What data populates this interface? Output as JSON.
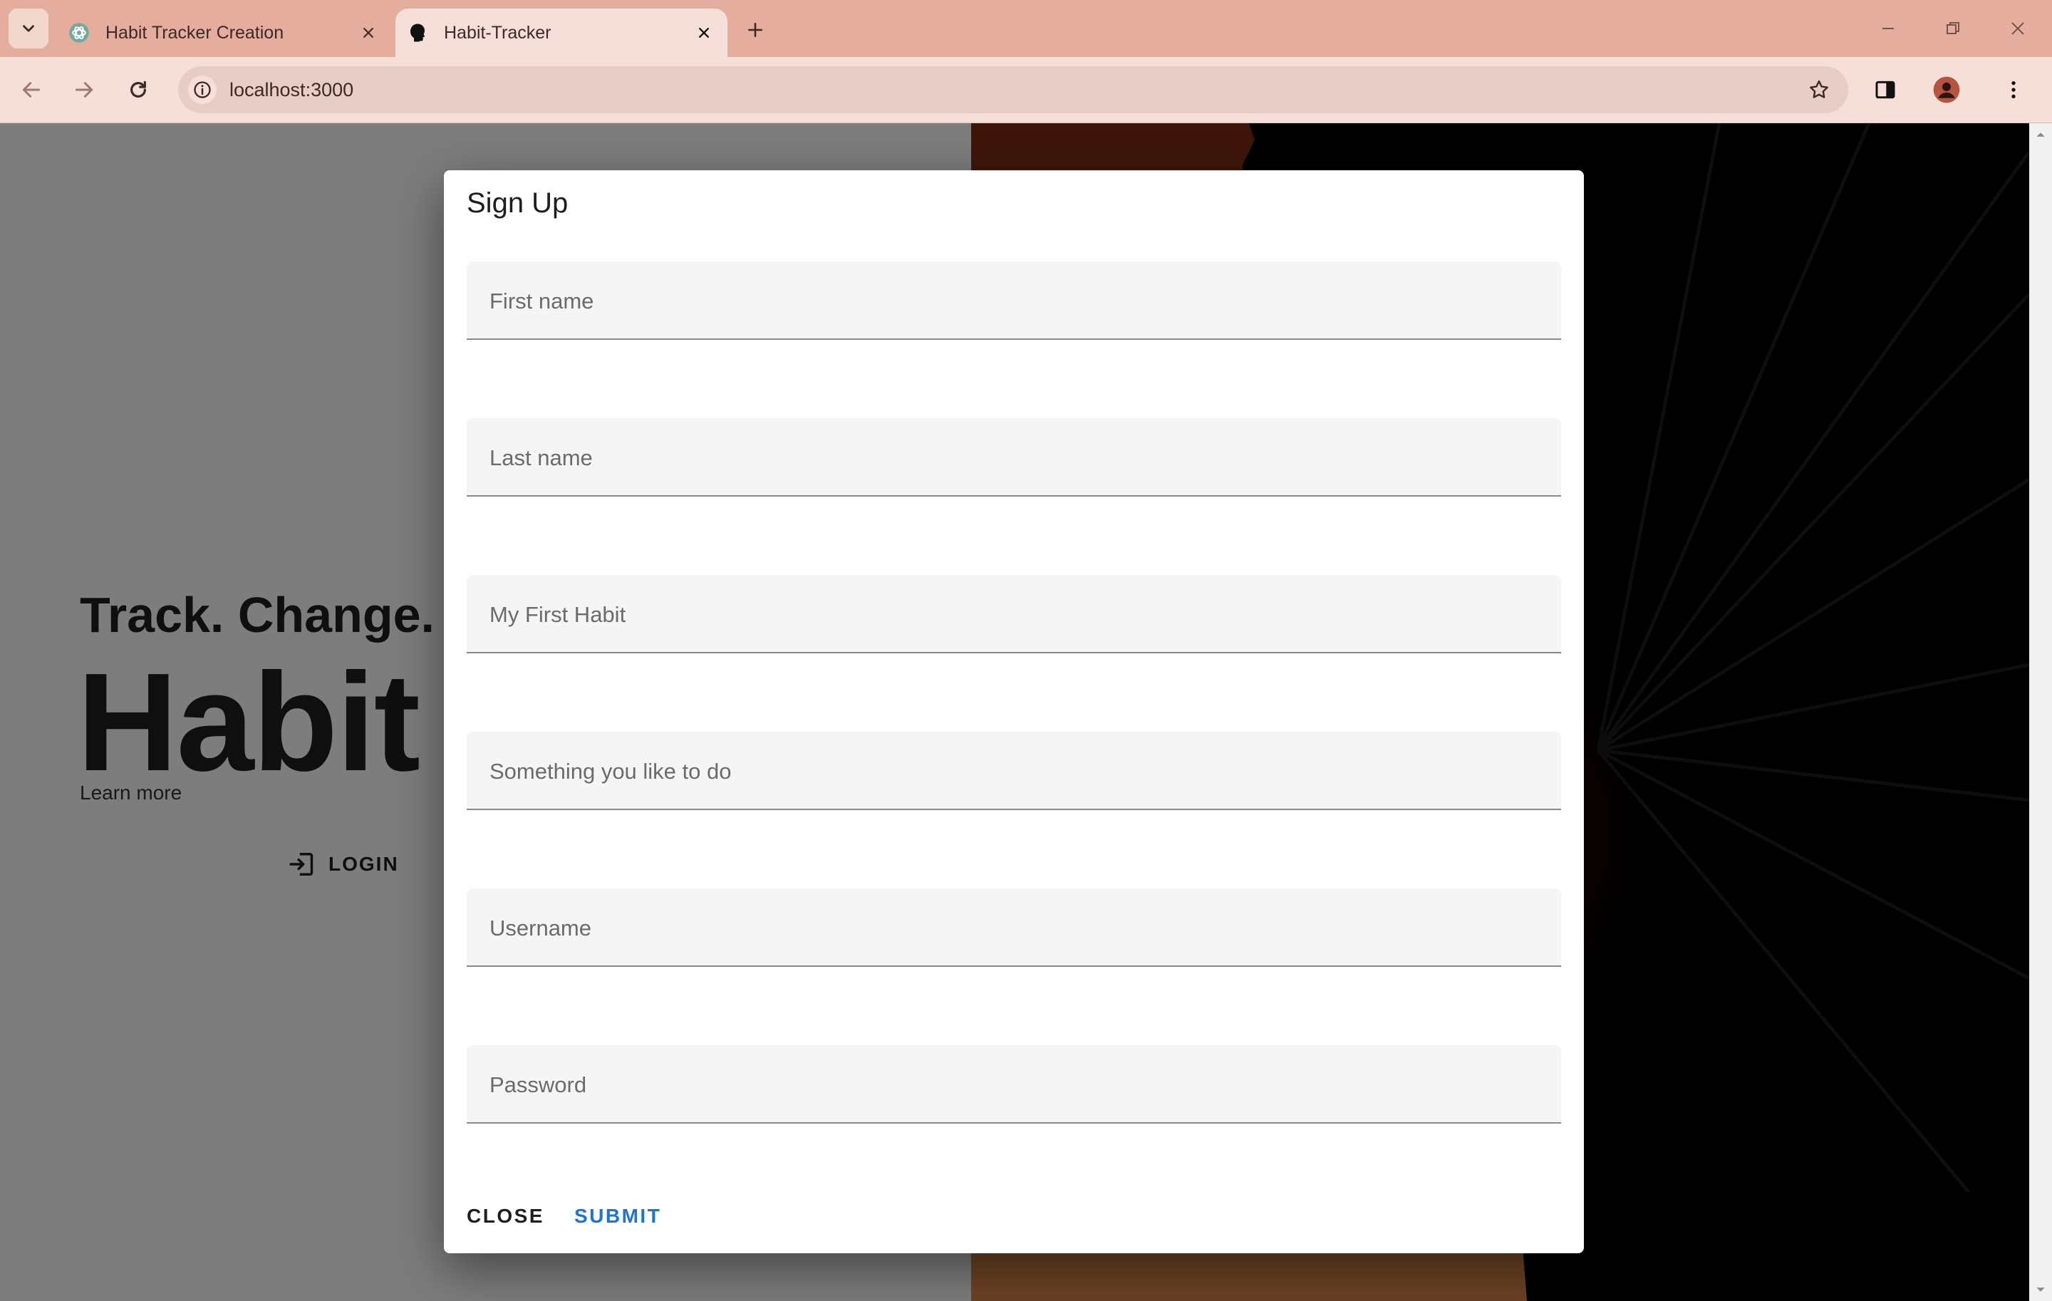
{
  "browser": {
    "tabs": [
      {
        "title": "Habit Tracker Creation",
        "icon": "openai-logo-icon",
        "active": false
      },
      {
        "title": "Habit-Tracker",
        "icon": "head-silhouette-icon",
        "active": true
      }
    ],
    "url": "localhost:3000",
    "colors": {
      "tabbar": "#e4ad9e",
      "toolbar": "#f6dfd8",
      "omnibox": "#e7cdc5"
    }
  },
  "page": {
    "hero_subtitle": "Track. Change. G",
    "hero_title": "Habit T",
    "learn_more": "Learn more",
    "login_label": "LOGIN"
  },
  "dialog": {
    "title": "Sign Up",
    "fields": [
      {
        "label": "First name",
        "value": ""
      },
      {
        "label": "Last name",
        "value": ""
      },
      {
        "label": "My First Habit",
        "value": ""
      },
      {
        "label": "Something you like to do",
        "value": ""
      },
      {
        "label": "Username",
        "value": ""
      },
      {
        "label": "Password",
        "value": ""
      }
    ],
    "close_label": "CLOSE",
    "submit_label": "SUBMIT",
    "colors": {
      "submit": "#1976d2"
    }
  }
}
